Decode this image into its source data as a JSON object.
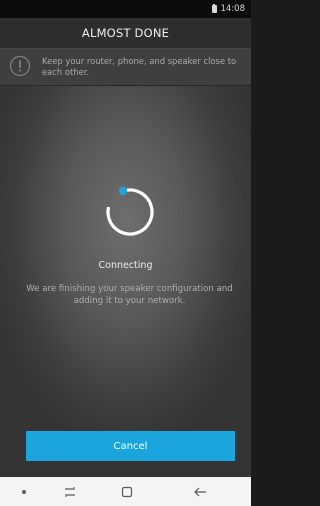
{
  "status_bar": {
    "time": "14:08",
    "battery_icon": "battery-icon"
  },
  "header": {
    "title": "ALMOST DONE"
  },
  "notice": {
    "icon": "alert-icon",
    "text": "Keep your router, phone, and speaker close to each other."
  },
  "progress": {
    "icon": "loading-spinner",
    "status": "Connecting",
    "message": "We are finishing your speaker configuration and adding it to your network."
  },
  "actions": {
    "cancel_label": "Cancel"
  },
  "nav_bar": {
    "items": [
      "dot-icon",
      "recent-apps-icon",
      "home-icon",
      "back-icon"
    ]
  },
  "colors": {
    "accent": "#1ba5dc",
    "title_bar": "#2e2e2e",
    "notice_bg": "#3f3f3f",
    "status_bar": "#0c0c0c",
    "nav_bar": "#f4f4f4"
  }
}
